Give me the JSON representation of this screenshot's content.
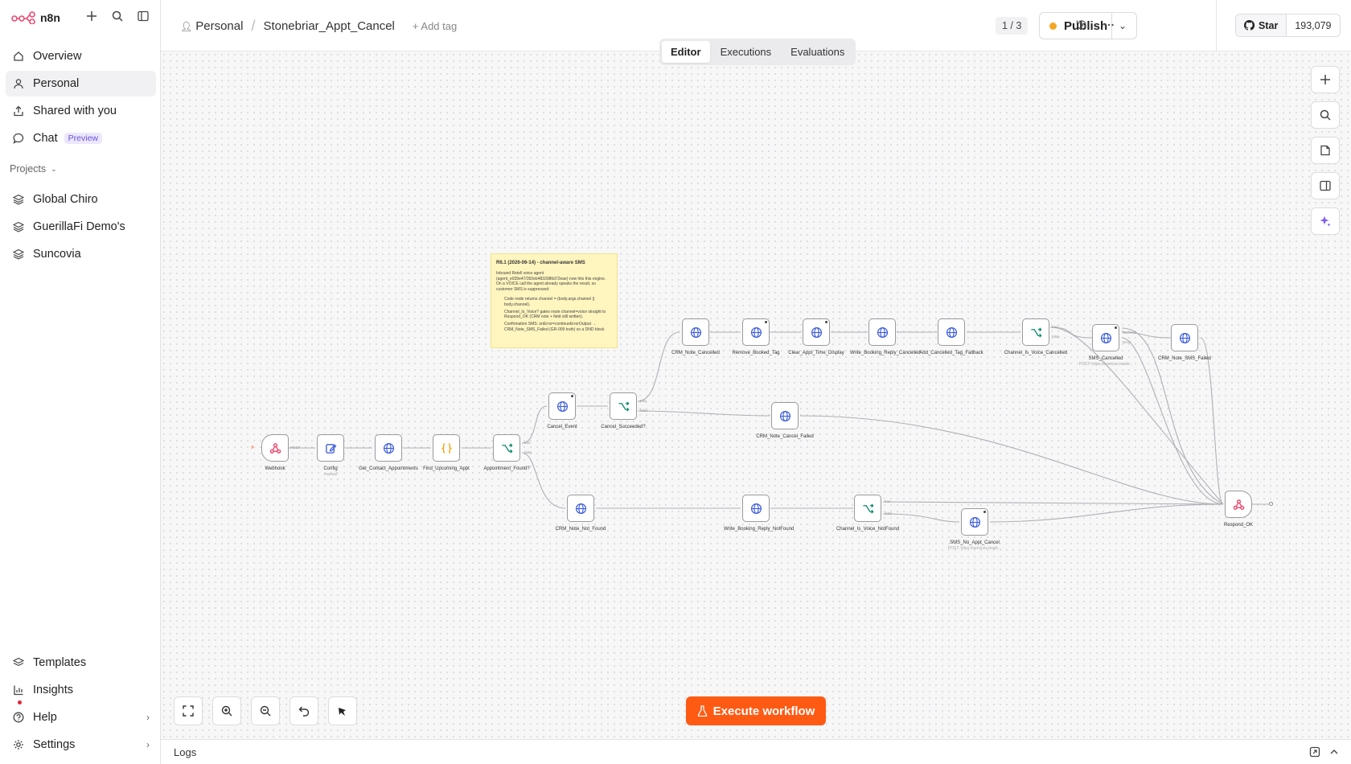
{
  "brand": {
    "name": "n8n",
    "accent": "#ea4b71"
  },
  "sidebar": {
    "nav": [
      {
        "label": "Overview",
        "icon": "home-icon"
      },
      {
        "label": "Personal",
        "icon": "user-icon"
      },
      {
        "label": "Shared with you",
        "icon": "share-icon"
      },
      {
        "label": "Chat",
        "icon": "chat-icon",
        "badge": "Preview"
      }
    ],
    "projects_heading": "Projects",
    "projects": [
      "Global Chiro",
      "GuerillaFi Demo's",
      "Suncovia"
    ],
    "bottom": [
      {
        "label": "Templates",
        "icon": "templates-icon"
      },
      {
        "label": "Insights",
        "icon": "insights-icon"
      },
      {
        "label": "Help",
        "icon": "help-icon"
      },
      {
        "label": "Settings",
        "icon": "settings-icon"
      }
    ]
  },
  "header": {
    "project": "Personal",
    "workflow": "Stonebriar_Appt_Cancel",
    "add_tag": "+ Add tag",
    "pager": "1 / 3",
    "publish": "Publish",
    "publish_dot_color": "#f5a623",
    "github_star": "Star",
    "github_count": "193,079"
  },
  "tabs": [
    "Editor",
    "Executions",
    "Evaluations"
  ],
  "sticky": {
    "title": "R6.1 (2026-06-14) - channel-aware SMS",
    "body": "Inbound Retell voice agent (agent_e039e47/392eb4833986d72eae) now hits this engine. On a VOICE call the agent already speaks the result, so customer SMS is suppressed:",
    "bullets": [
      "Code node returns channel = (body.args.channel || body.channel).",
      "Channel_Is_Voice? gates route channel=voice straight to Respond_OK (CRM note + field still written).",
      "Confirmation SMS: onError=continueErrorOutput → CRM_Note_SMS_Failed (GR-009 truth) so a DND block"
    ]
  },
  "nodes": {
    "webhook": "Webhook",
    "config": "Config",
    "config_sub": "manual",
    "get_contact": "Get_Contact_Appointments",
    "find_upcoming": "Find_Upcoming_Appt",
    "appt_found": "Appointment_Found?",
    "cancel_event": "Cancel_Event",
    "cancel_succeeded": "Cancel_Succeeded?",
    "crm_note_cancelled": "CRM_Note_Cancelled",
    "remove_booked_tag": "Remove_Booked_Tag",
    "clear_appt_time": "Clear_Appt_Time_Display",
    "write_booking_cancelled": "Write_Booking_Reply_Cancelled",
    "add_cancelled_tag": "Add_Cancelled_Tag_Fallback",
    "channel_voice_cancelled": "Channel_Is_Voice_Cancelled",
    "sms_cancelled": "SMS_Cancelled",
    "sms_cancelled_sub": "POST: https://services.leadc...",
    "crm_note_sms_failed": "CRM_Note_SMS_Failed",
    "crm_note_cancel_failed": "CRM_Note_Cancel_Failed",
    "crm_note_not_found": "CRM_Note_Not_Found",
    "write_booking_notfound": "Write_Booking_Reply_NotFound",
    "channel_voice_notfound": "Channel_Is_Voice_NotFound",
    "sms_no_appt": "SMS_No_Appt_Cancel",
    "sms_no_appt_sub": "POST: https://services.leadc...",
    "respond_ok": "Respond_OK"
  },
  "port_labels": {
    "true": "true",
    "false": "false",
    "success": "Success",
    "error": "Error",
    "post": "POST"
  },
  "execute_label": "Execute workflow",
  "execute_color": "#ff5a14",
  "logs_label": "Logs"
}
